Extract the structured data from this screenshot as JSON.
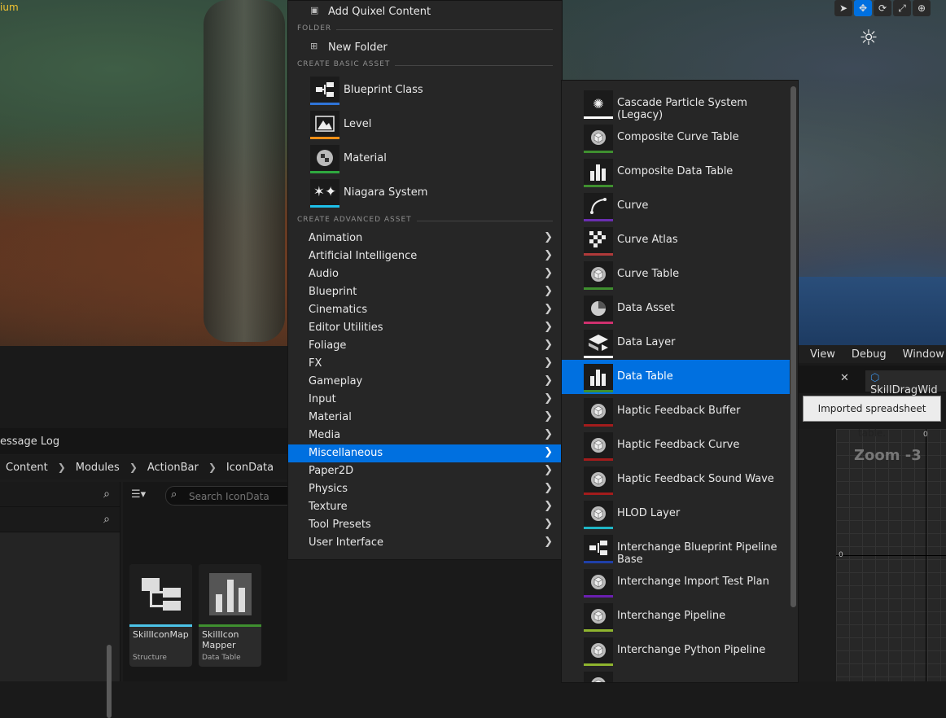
{
  "viewport": {
    "corner_label": "ium",
    "toolbar": [
      {
        "icon": "select-arrow-icon",
        "active": false
      },
      {
        "icon": "translate-icon",
        "active": true
      },
      {
        "icon": "rotate-icon",
        "active": false
      },
      {
        "icon": "scale-icon",
        "active": false
      },
      {
        "icon": "globe-icon",
        "active": false
      }
    ]
  },
  "context_menu": {
    "top_item": {
      "label": "Add Quixel Content",
      "icon": "quixel-icon"
    },
    "folder_section": "FOLDER",
    "new_folder": {
      "label": "New Folder",
      "icon": "new-folder-icon"
    },
    "basic_section": "CREATE BASIC ASSET",
    "basic_assets": [
      {
        "label": "Blueprint Class",
        "icon": "blueprint-class-icon",
        "color": "#2f74d8"
      },
      {
        "label": "Level",
        "icon": "level-icon",
        "color": "#ef8f16"
      },
      {
        "label": "Material",
        "icon": "material-icon",
        "color": "#2fa83f"
      },
      {
        "label": "Niagara System",
        "icon": "niagara-system-icon",
        "color": "#1ebfe8"
      }
    ],
    "advanced_section": "CREATE ADVANCED ASSET",
    "advanced_categories": [
      {
        "label": "Animation"
      },
      {
        "label": "Artificial Intelligence"
      },
      {
        "label": "Audio"
      },
      {
        "label": "Blueprint"
      },
      {
        "label": "Cinematics"
      },
      {
        "label": "Editor Utilities"
      },
      {
        "label": "Foliage"
      },
      {
        "label": "FX"
      },
      {
        "label": "Gameplay"
      },
      {
        "label": "Input"
      },
      {
        "label": "Material"
      },
      {
        "label": "Media"
      },
      {
        "label": "Miscellaneous",
        "selected": true
      },
      {
        "label": "Paper2D"
      },
      {
        "label": "Physics"
      },
      {
        "label": "Texture"
      },
      {
        "label": "Tool Presets"
      },
      {
        "label": "User Interface"
      }
    ]
  },
  "submenu": {
    "items": [
      {
        "label": "Cascade Particle System (Legacy)",
        "icon": "particle-sparkle-icon",
        "color": "#ffffff"
      },
      {
        "label": "Composite Curve Table",
        "icon": "cube-icon",
        "color": "#3f8f2f"
      },
      {
        "label": "Composite Data Table",
        "icon": "bar-chart-icon",
        "color": "#3f8f2f"
      },
      {
        "label": "Curve",
        "icon": "curve-icon",
        "color": "#6a2fb0"
      },
      {
        "label": "Curve Atlas",
        "icon": "checker-icon",
        "color": "#b03a3a"
      },
      {
        "label": "Curve Table",
        "icon": "cube-icon",
        "color": "#3f8f2f"
      },
      {
        "label": "Data Asset",
        "icon": "pie-chart-icon",
        "color": "#d0316f"
      },
      {
        "label": "Data Layer",
        "icon": "layers-icon",
        "color": "#ffffff"
      },
      {
        "label": "Data Table",
        "icon": "bar-chart-icon",
        "color": "#3f8f2f",
        "selected": true
      },
      {
        "label": "Haptic Feedback Buffer",
        "icon": "cube-icon",
        "color": "#a31c1c"
      },
      {
        "label": "Haptic Feedback Curve",
        "icon": "cube-icon",
        "color": "#a31c1c"
      },
      {
        "label": "Haptic Feedback Sound Wave",
        "icon": "cube-icon",
        "color": "#a31c1c"
      },
      {
        "label": "HLOD Layer",
        "icon": "cube-icon",
        "color": "#1fb5c4"
      },
      {
        "label": "Interchange Blueprint Pipeline Base",
        "icon": "blueprint-class-icon",
        "color": "#1f3fa8"
      },
      {
        "label": "Interchange Import Test Plan",
        "icon": "cube-icon",
        "color": "#6a1fb0"
      },
      {
        "label": "Interchange Pipeline",
        "icon": "cube-icon",
        "color": "#8fb52f"
      },
      {
        "label": "Interchange Python Pipeline",
        "icon": "cube-icon",
        "color": "#8fb52f"
      },
      {
        "label": "",
        "icon": "cube-icon",
        "color": "#8fb52f"
      }
    ]
  },
  "tooltip": "Imported spreadsheet table.",
  "editor": {
    "menu": [
      "View",
      "Debug",
      "Window"
    ],
    "tab_title": "SkillDragWid",
    "zoom": "Zoom -3",
    "axis_zero_top": "0",
    "axis_zero_left": "0"
  },
  "content_browser": {
    "tab_label": "essage Log",
    "breadcrumbs": [
      "Content",
      "Modules",
      "ActionBar",
      "IconData"
    ],
    "search_placeholder": "Search IconData",
    "assets": [
      {
        "name": "SkillIconMap",
        "type": "Structure",
        "accent": "#4cc3e8"
      },
      {
        "name": "SkillIcon Mapper",
        "type": "Data Table",
        "accent": "#3f8f2f"
      }
    ]
  }
}
